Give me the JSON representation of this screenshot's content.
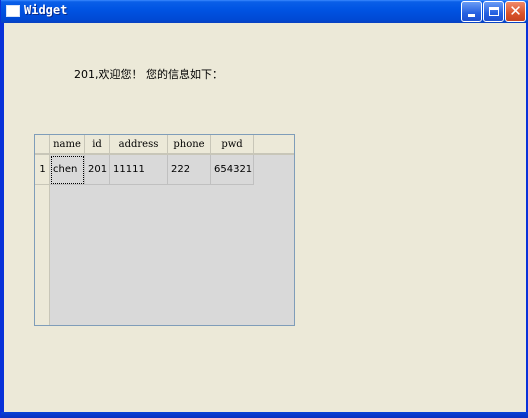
{
  "window": {
    "title": "Widget"
  },
  "welcome_text": "201,欢迎您！  您的信息如下：",
  "table": {
    "columns": [
      "name",
      "id",
      "address",
      "phone",
      "pwd"
    ],
    "rows": [
      {
        "row_number": "1",
        "cells": [
          "chen",
          "201",
          "11111",
          "222",
          "654321"
        ]
      }
    ]
  }
}
